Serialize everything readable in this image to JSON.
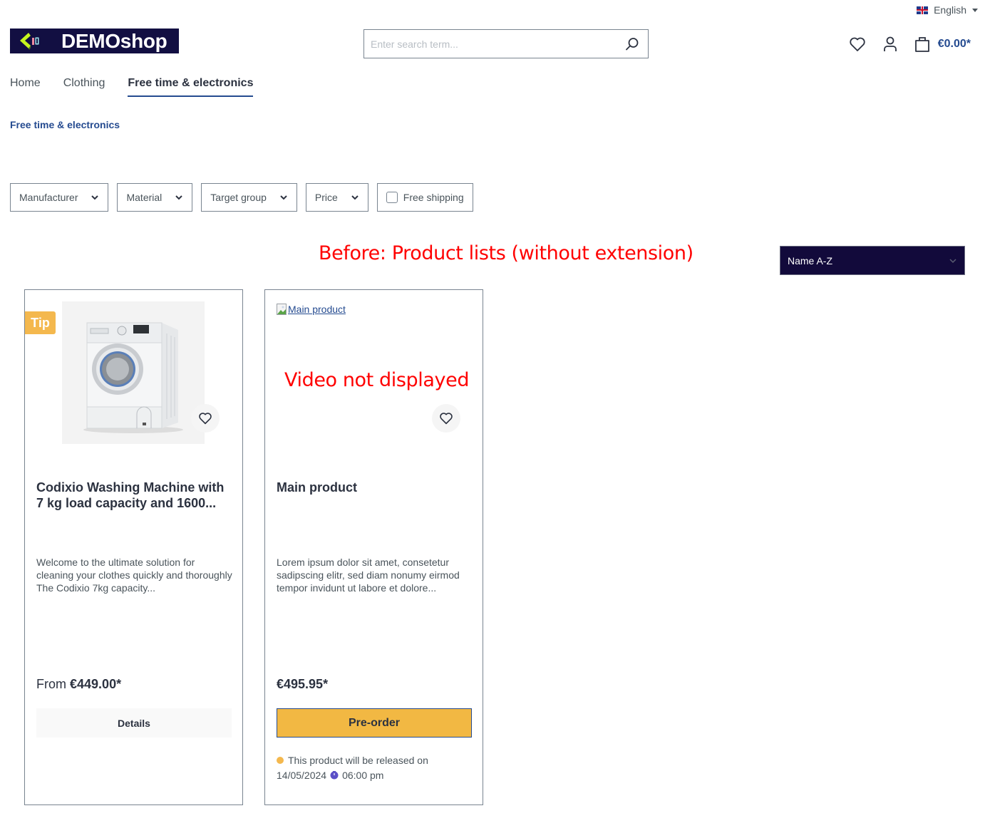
{
  "header": {
    "language": "English",
    "logo_text": "DEMOshop",
    "search_placeholder": "Enter search term...",
    "cart_total": "€0.00*",
    "icons": [
      "heart-icon",
      "user-icon",
      "shopping-bag-icon",
      "search-icon",
      "uk-flag-icon"
    ]
  },
  "nav": {
    "items": [
      {
        "label": "Home",
        "active": false
      },
      {
        "label": "Clothing",
        "active": false
      },
      {
        "label": "Free time & electronics",
        "active": true
      }
    ]
  },
  "breadcrumb": "Free time & electronics",
  "filters": [
    {
      "label": "Manufacturer",
      "type": "dropdown"
    },
    {
      "label": "Material",
      "type": "dropdown"
    },
    {
      "label": "Target group",
      "type": "dropdown"
    },
    {
      "label": "Price",
      "type": "dropdown"
    },
    {
      "label": "Free shipping",
      "type": "checkbox",
      "checked": false
    }
  ],
  "sort": {
    "selected": "Name A-Z"
  },
  "annotations": {
    "title": "Before:  Product lists (without extension)",
    "video_note": "Video not displayed"
  },
  "products": [
    {
      "badge": "Tip",
      "name": "Codixio Washing Machine with 7 kg load capacity and 1600...",
      "description": "Welcome to the ultimate solution for cleaning your clothes quickly and thoroughly The Codixio 7kg capacity...",
      "price_prefix": "From",
      "price": "€449.00*",
      "button": "Details"
    },
    {
      "image_alt": "Main product",
      "name": "Main product",
      "description": "Lorem ipsum dolor sit amet, consetetur sadipscing elitr, sed diam nonumy eirmod tempor invidunt ut labore et dolore...",
      "price": "€495.95*",
      "button": "Pre-order",
      "release_text": "This product will be released on",
      "release_date": "14/05/2024",
      "release_time": "06:00 pm",
      "colors": {
        "button": "#f2b843",
        "dot": "#f4b84e"
      }
    }
  ],
  "colors": {
    "brand_dark": "#120f42",
    "accent_blue": "#254b90",
    "sort_bg": "#120a3b",
    "annotation_red": "#ff0000",
    "tip_badge": "#f4b84e"
  }
}
